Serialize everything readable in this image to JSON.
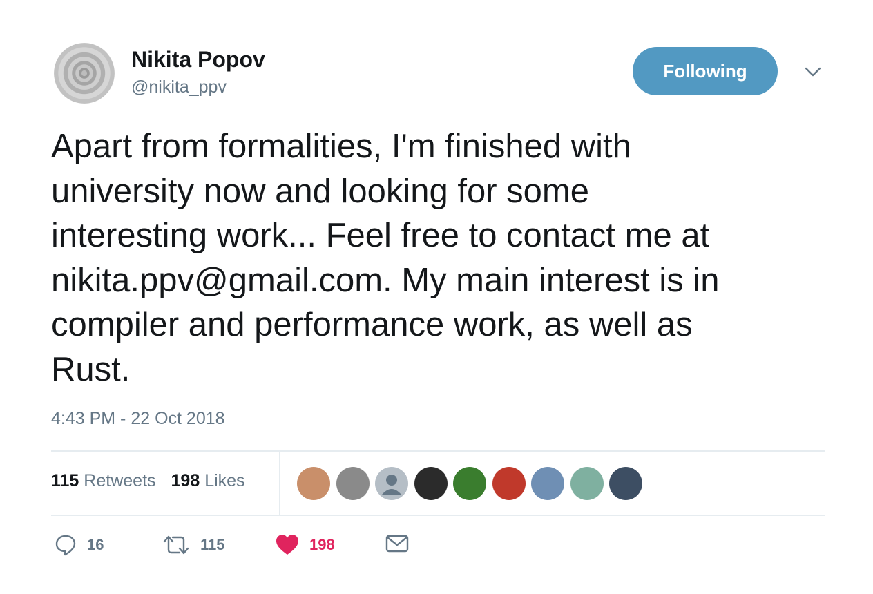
{
  "author": {
    "name": "Nikita Popov",
    "handle": "@nikita_ppv"
  },
  "follow_button": {
    "label": "Following"
  },
  "tweet": {
    "lines": [
      "Apart from formalities, I'm finished with",
      "university now and looking for some",
      "interesting work... Feel free to contact me at",
      "nikita.ppv@gmail.com. My main interest is in",
      "compiler and performance work, as well as",
      "Rust."
    ],
    "timestamp": "4:43 PM - 22 Oct 2018"
  },
  "stats": {
    "retweets_count": "115",
    "retweets_label": "Retweets",
    "likes_count": "198",
    "likes_label": "Likes"
  },
  "liker_avatars": [
    {
      "color": "#c98f6a"
    },
    {
      "color": "#8a8a8a"
    },
    {
      "color": "#b5bec6"
    },
    {
      "color": "#2b2b2b"
    },
    {
      "color": "#3a7d2e"
    },
    {
      "color": "#c0392b"
    },
    {
      "color": "#6f8fb4"
    },
    {
      "color": "#7fb0a0"
    },
    {
      "color": "#3d4e63"
    }
  ],
  "actions": {
    "reply_count": "16",
    "retweet_count": "115",
    "like_count": "198",
    "like_color": "#e0245e",
    "icons": [
      "reply-icon",
      "retweet-icon",
      "heart-icon",
      "envelope-icon"
    ]
  }
}
